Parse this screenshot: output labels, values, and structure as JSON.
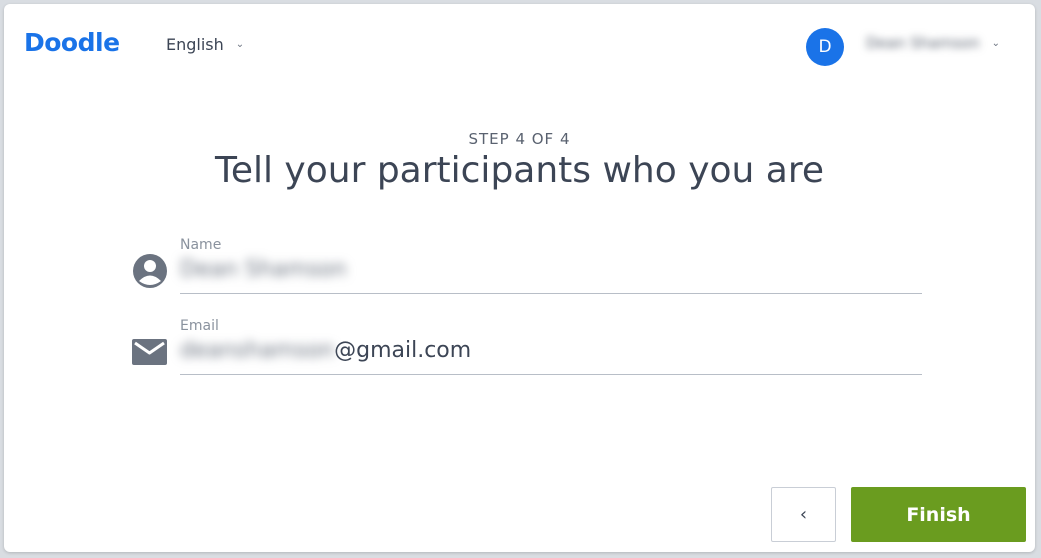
{
  "header": {
    "logo": "Doodle",
    "language": "English",
    "avatar_initial": "D",
    "user_name": "Dean Shamson"
  },
  "step": {
    "label": "STEP 4 OF 4",
    "title": "Tell your participants who you are"
  },
  "form": {
    "name": {
      "label": "Name",
      "value": "Dean Shamson"
    },
    "email": {
      "label": "Email",
      "value_local": "deanshamson",
      "value_domain": "@gmail.com"
    }
  },
  "footer": {
    "back_label": "‹",
    "finish_label": "Finish"
  },
  "colors": {
    "brand": "#1a73e8",
    "finish": "#6a9c1f",
    "text": "#3c4555"
  },
  "icons": [
    "chevron-down-icon",
    "user-circle-icon",
    "mail-icon",
    "chevron-left-icon"
  ]
}
